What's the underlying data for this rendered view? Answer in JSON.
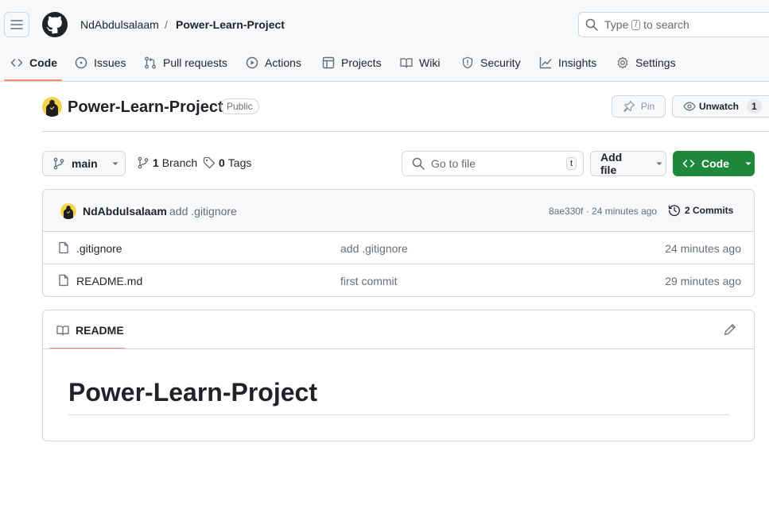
{
  "breadcrumb": {
    "owner": "NdAbdulsalaam",
    "separator": "/",
    "repo": "Power-Learn-Project"
  },
  "search": {
    "placeholder_before": "Type",
    "shortcut_key": "/",
    "placeholder_after": "to search"
  },
  "nav_tabs": [
    {
      "label": "Code",
      "icon": "code-icon"
    },
    {
      "label": "Issues",
      "icon": "issue-icon"
    },
    {
      "label": "Pull requests",
      "icon": "pull-request-icon"
    },
    {
      "label": "Actions",
      "icon": "play-icon"
    },
    {
      "label": "Projects",
      "icon": "table-icon"
    },
    {
      "label": "Wiki",
      "icon": "book-icon"
    },
    {
      "label": "Security",
      "icon": "shield-icon"
    },
    {
      "label": "Insights",
      "icon": "graph-icon"
    },
    {
      "label": "Settings",
      "icon": "gear-icon"
    }
  ],
  "repo": {
    "name": "Power-Learn-Project",
    "visibility": "Public",
    "pin_label": "Pin",
    "watch_label": "Unwatch",
    "watch_count": "1"
  },
  "toolbar": {
    "branch": "main",
    "branch_count": "1",
    "branch_word": "Branch",
    "tag_count": "0",
    "tag_word": "Tags",
    "goto_placeholder": "Go to file",
    "goto_shortcut": "t",
    "add_file_label": "Add file",
    "code_label": "Code"
  },
  "latest_commit": {
    "author": "NdAbdulsalaam",
    "message": "add .gitignore",
    "meta": "8ae330f · 24 minutes ago",
    "commits_label": "2 Commits"
  },
  "files": [
    {
      "name": ".gitignore",
      "message": "add .gitignore",
      "age": "24 minutes ago"
    },
    {
      "name": "README.md",
      "message": "first commit",
      "age": "29 minutes ago"
    }
  ],
  "readme": {
    "tab_label": "README",
    "heading": "Power-Learn-Project"
  },
  "colors": {
    "accent_underline": "#fd8c73",
    "primary_button": "#1f883d",
    "border": "#d0d7de",
    "muted_text": "#656d76"
  }
}
